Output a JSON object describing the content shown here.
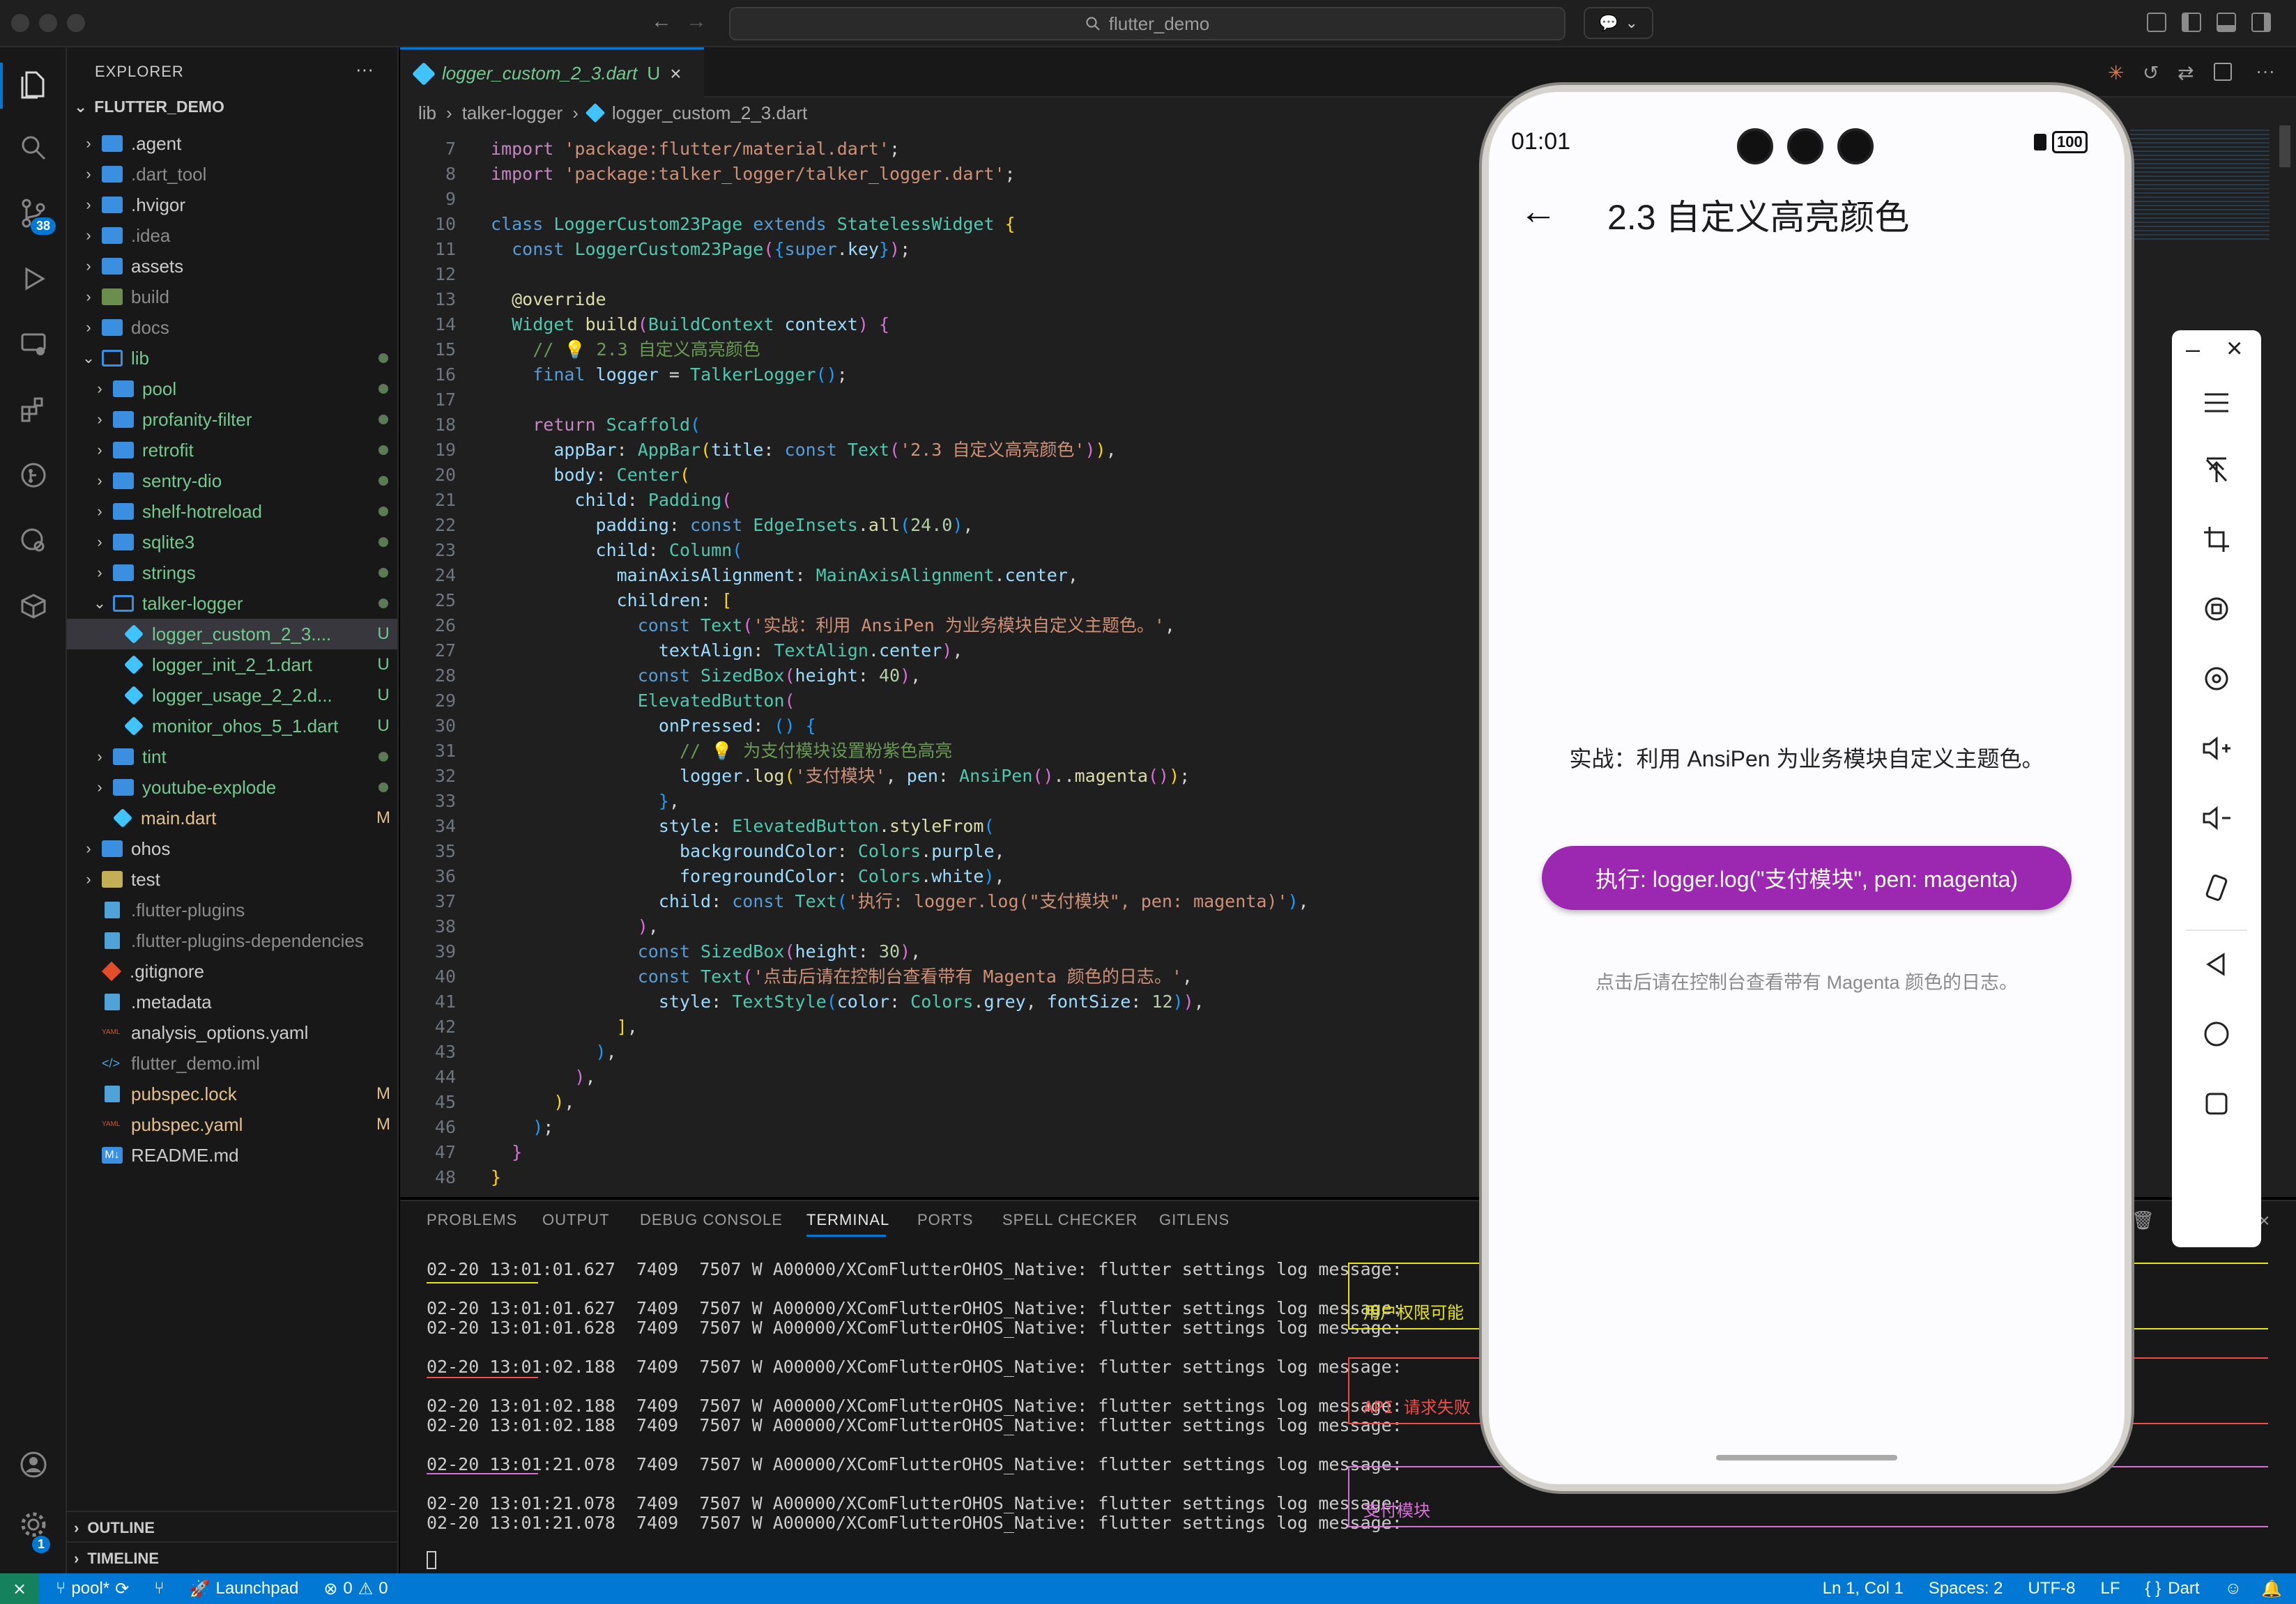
{
  "window": {
    "search": "flutter_demo"
  },
  "activity": {
    "scm_badge": "38",
    "settings_badge": "1"
  },
  "explorer": {
    "title": "EXPLORER",
    "more": "···",
    "root": "FLUTTER_DEMO",
    "items": [
      {
        "label": ".agent",
        "indent": 0,
        "kind": "folder",
        "collapsed": true,
        "color": "#cccccc",
        "status": ""
      },
      {
        "label": ".dart_tool",
        "indent": 0,
        "kind": "folder",
        "collapsed": true,
        "color": "#8b8b8b",
        "status": ""
      },
      {
        "label": ".hvigor",
        "indent": 0,
        "kind": "folder",
        "collapsed": true,
        "color": "#cccccc",
        "status": ""
      },
      {
        "label": ".idea",
        "indent": 0,
        "kind": "folder",
        "collapsed": true,
        "color": "#8b8b8b",
        "status": ""
      },
      {
        "label": "assets",
        "indent": 0,
        "kind": "folder",
        "collapsed": true,
        "color": "#cccccc",
        "status": ""
      },
      {
        "label": "build",
        "indent": 0,
        "kind": "folder-build",
        "collapsed": true,
        "color": "#8b8b8b",
        "status": ""
      },
      {
        "label": "docs",
        "indent": 0,
        "kind": "folder",
        "collapsed": true,
        "color": "#8b8b8b",
        "status": ""
      },
      {
        "label": "lib",
        "indent": 0,
        "kind": "folder-open",
        "collapsed": false,
        "color": "#73c991",
        "status": "dot"
      },
      {
        "label": "pool",
        "indent": 1,
        "kind": "folder",
        "collapsed": true,
        "color": "#73c991",
        "status": "dot"
      },
      {
        "label": "profanity-filter",
        "indent": 1,
        "kind": "folder",
        "collapsed": true,
        "color": "#73c991",
        "status": "dot"
      },
      {
        "label": "retrofit",
        "indent": 1,
        "kind": "folder",
        "collapsed": true,
        "color": "#73c991",
        "status": "dot"
      },
      {
        "label": "sentry-dio",
        "indent": 1,
        "kind": "folder",
        "collapsed": true,
        "color": "#73c991",
        "status": "dot"
      },
      {
        "label": "shelf-hotreload",
        "indent": 1,
        "kind": "folder",
        "collapsed": true,
        "color": "#73c991",
        "status": "dot"
      },
      {
        "label": "sqlite3",
        "indent": 1,
        "kind": "folder",
        "collapsed": true,
        "color": "#73c991",
        "status": "dot"
      },
      {
        "label": "strings",
        "indent": 1,
        "kind": "folder",
        "collapsed": true,
        "color": "#73c991",
        "status": "dot"
      },
      {
        "label": "talker-logger",
        "indent": 1,
        "kind": "folder-open",
        "collapsed": false,
        "color": "#73c991",
        "status": "dot"
      },
      {
        "label": "logger_custom_2_3....",
        "indent": 2,
        "kind": "dart",
        "color": "#73c991",
        "status": "U",
        "selected": true
      },
      {
        "label": "logger_init_2_1.dart",
        "indent": 2,
        "kind": "dart",
        "color": "#73c991",
        "status": "U"
      },
      {
        "label": "logger_usage_2_2.d...",
        "indent": 2,
        "kind": "dart",
        "color": "#73c991",
        "status": "U"
      },
      {
        "label": "monitor_ohos_5_1.dart",
        "indent": 2,
        "kind": "dart",
        "color": "#73c991",
        "status": "U"
      },
      {
        "label": "tint",
        "indent": 1,
        "kind": "folder",
        "collapsed": true,
        "color": "#73c991",
        "status": "dot"
      },
      {
        "label": "youtube-explode",
        "indent": 1,
        "kind": "folder",
        "collapsed": true,
        "color": "#73c991",
        "status": "dot"
      },
      {
        "label": "main.dart",
        "indent": 1,
        "kind": "dart",
        "color": "#e2c08d",
        "status": "M"
      },
      {
        "label": "ohos",
        "indent": 0,
        "kind": "folder",
        "collapsed": true,
        "color": "#cccccc",
        "status": ""
      },
      {
        "label": "test",
        "indent": 0,
        "kind": "folder-test",
        "collapsed": true,
        "color": "#cccccc",
        "status": ""
      },
      {
        "label": ".flutter-plugins",
        "indent": 0,
        "kind": "file",
        "color": "#8b8b8b",
        "status": ""
      },
      {
        "label": ".flutter-plugins-dependencies",
        "indent": 0,
        "kind": "file",
        "color": "#8b8b8b",
        "status": ""
      },
      {
        "label": ".gitignore",
        "indent": 0,
        "kind": "git",
        "color": "#cccccc",
        "status": ""
      },
      {
        "label": ".metadata",
        "indent": 0,
        "kind": "file",
        "color": "#cccccc",
        "status": ""
      },
      {
        "label": "analysis_options.yaml",
        "indent": 0,
        "kind": "yaml",
        "color": "#cccccc",
        "status": ""
      },
      {
        "label": "flutter_demo.iml",
        "indent": 0,
        "kind": "xml",
        "color": "#8b8b8b",
        "status": ""
      },
      {
        "label": "pubspec.lock",
        "indent": 0,
        "kind": "file",
        "color": "#e2c08d",
        "status": "M"
      },
      {
        "label": "pubspec.yaml",
        "indent": 0,
        "kind": "yaml",
        "color": "#e2c08d",
        "status": "M"
      },
      {
        "label": "README.md",
        "indent": 0,
        "kind": "md",
        "color": "#cccccc",
        "status": ""
      }
    ],
    "outline": "OUTLINE",
    "timeline": "TIMELINE"
  },
  "editor": {
    "tab_label": "logger_custom_2_3.dart",
    "tab_status": "U",
    "breadcrumb": [
      "lib",
      "talker-logger",
      "logger_custom_2_3.dart"
    ],
    "line_numbers": [
      "7",
      "8",
      "9",
      "10",
      "11",
      "12",
      "13",
      "14",
      "15",
      "16",
      "17",
      "18",
      "19",
      "20",
      "21",
      "22",
      "23",
      "24",
      "25",
      "26",
      "27",
      "28",
      "29",
      "30",
      "31",
      "32",
      "33",
      "34",
      "35",
      "36",
      "37",
      "38",
      "39",
      "40",
      "41",
      "42",
      "43",
      "44",
      "45",
      "46",
      "47",
      "48"
    ]
  },
  "panel": {
    "tabs": [
      "PROBLEMS",
      "OUTPUT",
      "DEBUG CONSOLE",
      "TERMINAL",
      "PORTS",
      "SPELL CHECKER",
      "GITLENS"
    ],
    "active_tab": "TERMINAL",
    "lines": [
      "02-20 13:01:01.627  7409  7507 W A00000/XComFlutterOHOS_Native: flutter settings log message:",
      "02-20 13:01:01.627  7409  7507 W A00000/XComFlutterOHOS_Native: flutter settings log message:",
      "02-20 13:01:01.628  7409  7507 W A00000/XComFlutterOHOS_Native: flutter settings log message:",
      "02-20 13:01:02.188  7409  7507 W A00000/XComFlutterOHOS_Native: flutter settings log message:",
      "02-20 13:01:02.188  7409  7507 W A00000/XComFlutterOHOS_Native: flutter settings log message:",
      "02-20 13:01:02.188  7409  7507 W A00000/XComFlutterOHOS_Native: flutter settings log message:",
      "02-20 13:01:21.078  7409  7507 W A00000/XComFlutterOHOS_Native: flutter settings log message:",
      "02-20 13:01:21.078  7409  7507 W A00000/XComFlutterOHOS_Native: flutter settings log message:",
      "02-20 13:01:21.078  7409  7507 W A00000/XComFlutterOHOS_Native: flutter settings log message:"
    ],
    "box_labels": [
      "用户权限可能",
      "API 请求失败",
      "支付模块"
    ],
    "box_colors": [
      "#e5e510",
      "#f14c4c",
      "#d670d6"
    ]
  },
  "phone": {
    "time": "01:01",
    "battery": "100",
    "appbar_title": "2.3 自定义高亮颜色",
    "body_text": "实战：利用 AnsiPen 为业务模块自定义主题色。",
    "button_label": "执行: logger.log(\"支付模块\", pen: magenta)",
    "hint_text": "点击后请在控制台查看带有 Magenta 颜色的日志。",
    "button_color": "#9c27b0"
  },
  "statusbar": {
    "branch": "pool*",
    "launchpad": "Launchpad",
    "errors": "0",
    "warnings": "0",
    "position": "Ln 1, Col 1",
    "spaces": "Spaces: 2",
    "encoding": "UTF-8",
    "eol": "LF",
    "language": "Dart"
  }
}
